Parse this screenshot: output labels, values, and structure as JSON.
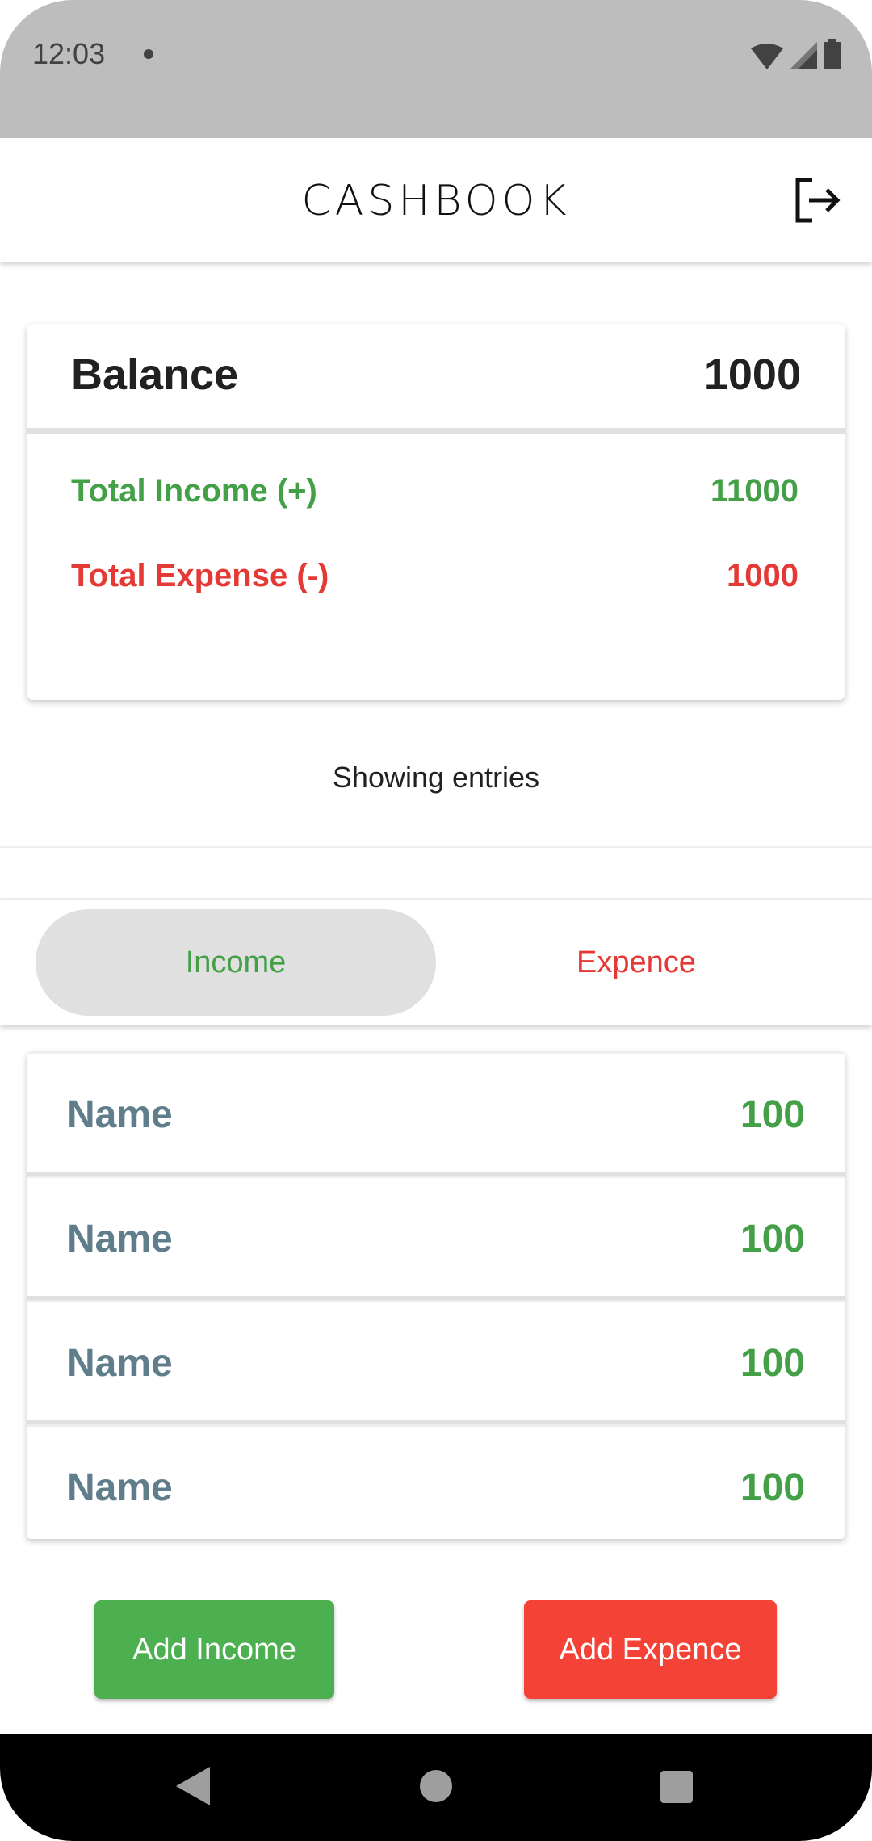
{
  "status_bar": {
    "time": "12:03"
  },
  "app_bar": {
    "title": "CASHBOOK",
    "logout_icon": "logout-icon"
  },
  "summary": {
    "balance_label": "Balance",
    "balance_value": "1000",
    "income_label": "Total Income (+)",
    "income_value": "11000",
    "expense_label": "Total Expense (-)",
    "expense_value": "1000"
  },
  "showing_text": "Showing entries",
  "tabs": [
    {
      "label": "Income",
      "selected": true
    },
    {
      "label": "Expence",
      "selected": false
    }
  ],
  "entries": [
    {
      "name": "Name",
      "amount": "100"
    },
    {
      "name": "Name",
      "amount": "100"
    },
    {
      "name": "Name",
      "amount": "100"
    },
    {
      "name": "Name",
      "amount": "100"
    }
  ],
  "buttons": {
    "add_income": "Add Income",
    "add_expense": "Add Expence"
  },
  "colors": {
    "income": "#43a047",
    "expense": "#e53935",
    "add_income_bg": "#4caf50",
    "add_expense_bg": "#f44336"
  }
}
